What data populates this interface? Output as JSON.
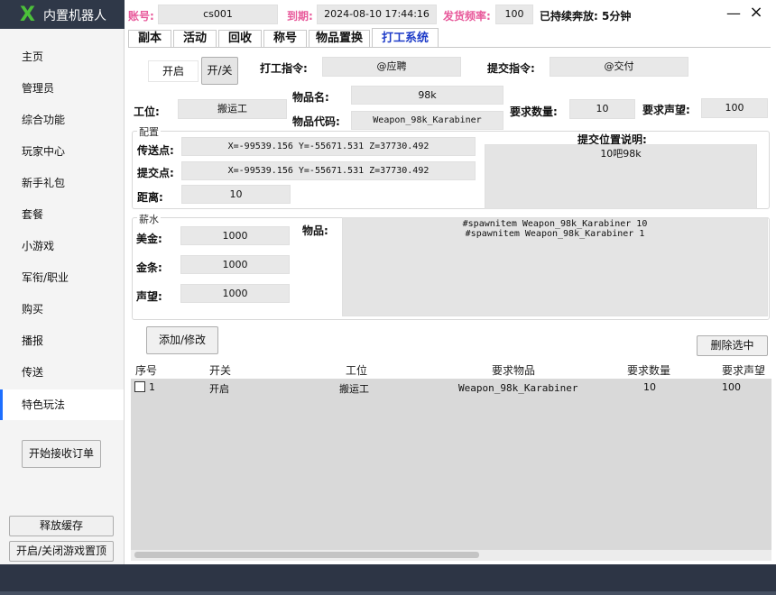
{
  "header": {
    "logo_text": "内置机器人",
    "account_label": "账号:",
    "account_value": "cs001",
    "expiry_label": "到期:",
    "expiry_value": "2024-08-10 17:44:16",
    "freq_label": "发货频率:",
    "freq_value": "100",
    "status_text": "已持续奔放: 5分钟",
    "minimize": "—",
    "close": "×"
  },
  "sidebar": {
    "items": [
      {
        "label": "主页"
      },
      {
        "label": "管理员"
      },
      {
        "label": "综合功能"
      },
      {
        "label": "玩家中心"
      },
      {
        "label": "新手礼包"
      },
      {
        "label": "套餐"
      },
      {
        "label": "小游戏"
      },
      {
        "label": "军衔/职业"
      },
      {
        "label": "购买"
      },
      {
        "label": "播报"
      },
      {
        "label": "传送"
      },
      {
        "label": "特色玩法"
      }
    ],
    "start_orders": "开始接收订单",
    "release_cache": "释放缓存",
    "toggle_pin": "开启/关闭游戏置顶"
  },
  "tabs": [
    "副本",
    "活动",
    "回收",
    "称号",
    "物品置换",
    "打工系统"
  ],
  "work": {
    "on_state": "开启",
    "toggle_btn": "开/关",
    "work_cmd_label": "打工指令:",
    "work_cmd_value": "@应聘",
    "submit_cmd_label": "提交指令:",
    "submit_cmd_value": "@交付",
    "position_label": "工位:",
    "position_value": "搬运工",
    "item_name_label": "物品名:",
    "item_name_value": "98k",
    "item_code_label": "物品代码:",
    "item_code_value": "Weapon_98k_Karabiner",
    "req_qty_label": "要求数量:",
    "req_qty_value": "10",
    "req_rep_label": "要求声望:",
    "req_rep_value": "100"
  },
  "config": {
    "group_label": "配置",
    "teleport_label": "传送点:",
    "teleport_value": "X=-99539.156 Y=-55671.531 Z=37730.492",
    "submit_point_label": "提交点:",
    "submit_point_value": "X=-99539.156 Y=-55671.531 Z=37730.492",
    "distance_label": "距离:",
    "distance_value": "10",
    "desc_label": "提交位置说明:",
    "desc_value": "10吧98k"
  },
  "salary": {
    "group_label": "薪水",
    "usd_label": "美金:",
    "usd_value": "1000",
    "gold_label": "金条:",
    "gold_value": "1000",
    "rep_label": "声望:",
    "rep_value": "1000",
    "items_label": "物品:",
    "items_line1": "#spawnitem Weapon_98k_Karabiner 10",
    "items_line2": "#spawnitem Weapon_98k_Karabiner 1"
  },
  "actions": {
    "add_modify": "添加/修改",
    "delete_selected": "删除选中"
  },
  "table": {
    "headers": [
      "序号",
      "开关",
      "工位",
      "要求物品",
      "要求数量",
      "要求声望"
    ],
    "rows": [
      [
        "1",
        "开启",
        "搬运工",
        "Weapon_98k_Karabiner",
        "10",
        "100"
      ]
    ]
  }
}
